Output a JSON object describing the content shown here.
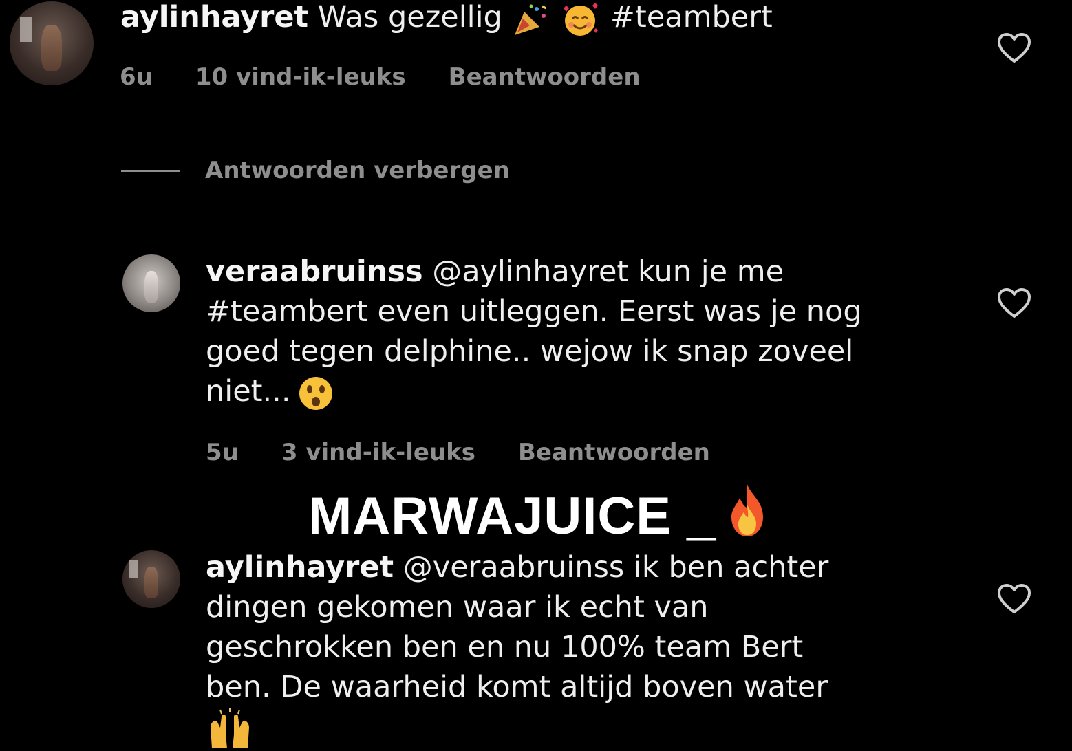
{
  "comments": [
    {
      "username": "aylinhayret",
      "text": "Was gezellig",
      "emojis": [
        "party-popper",
        "smiling-face-with-hearts"
      ],
      "hashtag": "#teambert",
      "time": "6u",
      "likes": "10 vind-ik-leuks",
      "reply_label": "Beantwoorden"
    }
  ],
  "hide_replies_label": "Antwoorden verbergen",
  "replies": [
    {
      "username": "veraabruinss",
      "lines": [
        "@aylinhayret kun je me",
        "#teambert even uitleggen. Eerst was je nog",
        "goed tegen delphine.. wejow ik snap zoveel",
        "niet..."
      ],
      "emoji": "astonished-face",
      "time": "5u",
      "likes": "3 vind-ik-leuks",
      "reply_label": "Beantwoorden"
    },
    {
      "username": "aylinhayret",
      "lines": [
        "@veraabruinss ik ben achter",
        "dingen gekomen waar ik echt van",
        "geschrokken ben en nu 100% team Bert",
        "ben. De waarheid komt altijd boven water"
      ],
      "emoji": "raising-hands"
    }
  ],
  "watermark": {
    "text": "MARWAJUICE _",
    "emoji": "fire"
  },
  "colors": {
    "background": "#000000",
    "text": "#efefef",
    "meta": "#8e8e8e",
    "heart_outline": "#cfcfcf"
  }
}
